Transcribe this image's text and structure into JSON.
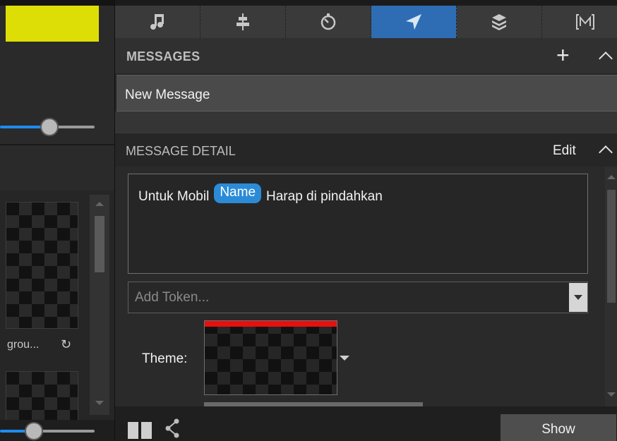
{
  "left_panel": {
    "preview_color": "#dede07",
    "item_label": "grou...",
    "item_icon": "loop-icon",
    "thumbnail_icon": "checker-thumbnail"
  },
  "tabs": [
    {
      "icon": "music-note-icon",
      "active": false
    },
    {
      "icon": "alignment-icon",
      "active": false
    },
    {
      "icon": "timer-icon",
      "active": false
    },
    {
      "icon": "send-arrow-icon",
      "active": true
    },
    {
      "icon": "layers-icon",
      "active": false
    },
    {
      "icon": "macro-m-icon",
      "active": false
    }
  ],
  "messages": {
    "title": "MESSAGES",
    "add_icon": "plus-icon",
    "collapse_icon": "chevron-up-icon",
    "items": [
      {
        "label": "New Message"
      }
    ]
  },
  "detail": {
    "title": "MESSAGE DETAIL",
    "edit_label": "Edit",
    "text_before": "Untuk Mobil",
    "token": "Name",
    "text_after": "Harap di pindahkan",
    "token_placeholder": "Add Token...",
    "theme_label": "Theme:"
  },
  "bottom": {
    "layout_icon": "columns-icon",
    "share_icon": "share-icon",
    "show_label": "Show"
  },
  "colors": {
    "accent": "#2e6db4",
    "token": "#2b8bd6",
    "slider_fill": "#1e8cf0",
    "theme_bar": "#e80f0f"
  }
}
